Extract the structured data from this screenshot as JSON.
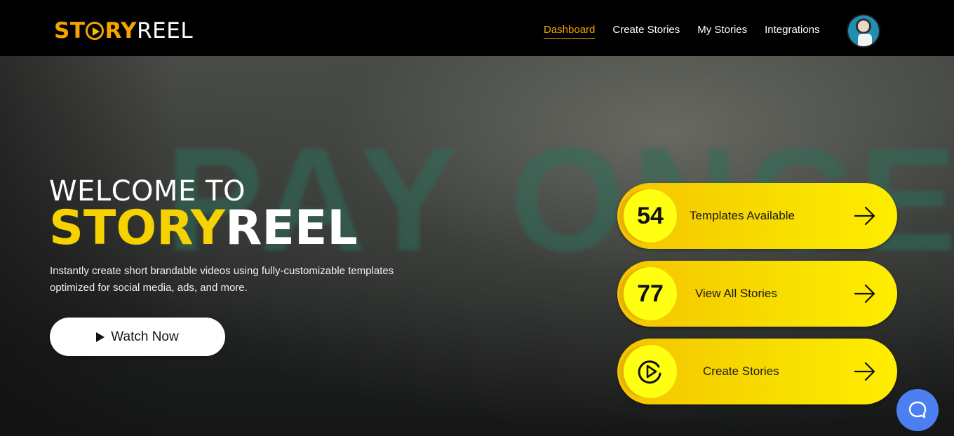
{
  "header": {
    "logo_story": "ST",
    "logo_story2": "RY",
    "logo_reel": "REEL",
    "nav": [
      {
        "label": "Dashboard",
        "active": true
      },
      {
        "label": "Create Stories"
      },
      {
        "label": "My Stories"
      },
      {
        "label": "Integrations"
      }
    ]
  },
  "hero": {
    "bg_text": "PAY ONCE!",
    "welcome": "WELCOME TO",
    "brand_yellow": "STORY",
    "brand_white": "REEL",
    "description": "Instantly create short brandable videos using fully-customizable templates optimized for social media, ads, and more.",
    "watch_button": "Watch Now"
  },
  "cards": [
    {
      "value": "54",
      "label": "Templates Available"
    },
    {
      "value": "77",
      "label": "View All Stories"
    },
    {
      "icon": "play-circle-icon",
      "label": "Create Stories"
    }
  ],
  "colors": {
    "accent": "#f5a300",
    "card_yellow": "#f7dc00",
    "chat": "#4c7ff0"
  }
}
